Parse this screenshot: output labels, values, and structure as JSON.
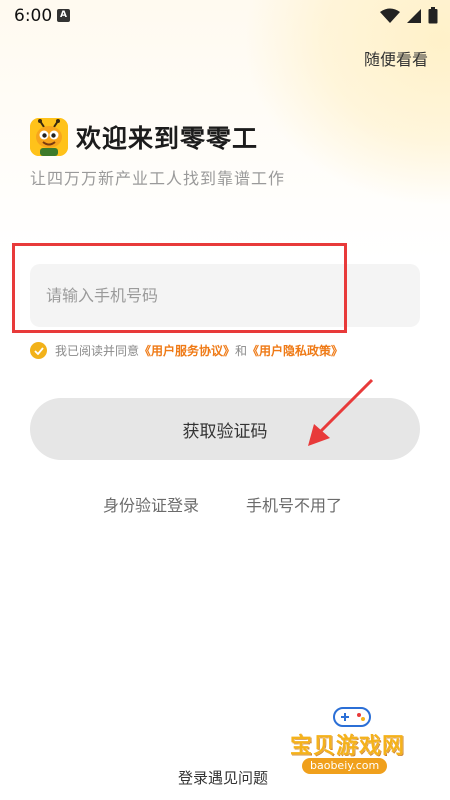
{
  "status_bar": {
    "time": "6:00",
    "notification_icon": "A"
  },
  "header": {
    "browse_label": "随便看看"
  },
  "brand": {
    "welcome": "欢迎来到零零工",
    "subtitle": "让四万万新产业工人找到靠谱工作"
  },
  "login": {
    "phone_placeholder": "请输入手机号码",
    "phone_value": "",
    "agreement_prefix": "我已阅读并同意",
    "user_agreement": "《用户服务协议》",
    "agreement_and": "和",
    "privacy_policy": "《用户隐私政策》",
    "agreed": true,
    "get_code_label": "获取验证码",
    "id_login_label": "身份验证登录",
    "phone_unavailable_label": "手机号不用了",
    "help_label": "登录遇见问题"
  },
  "watermark": {
    "title": "宝贝游戏网",
    "url": "baobeiy.com"
  },
  "colors": {
    "accent_orange": "#ef7a16",
    "check_yellow": "#f2b21a",
    "annotation_red": "#e83a3a",
    "button_gray": "#e6e6e6"
  }
}
